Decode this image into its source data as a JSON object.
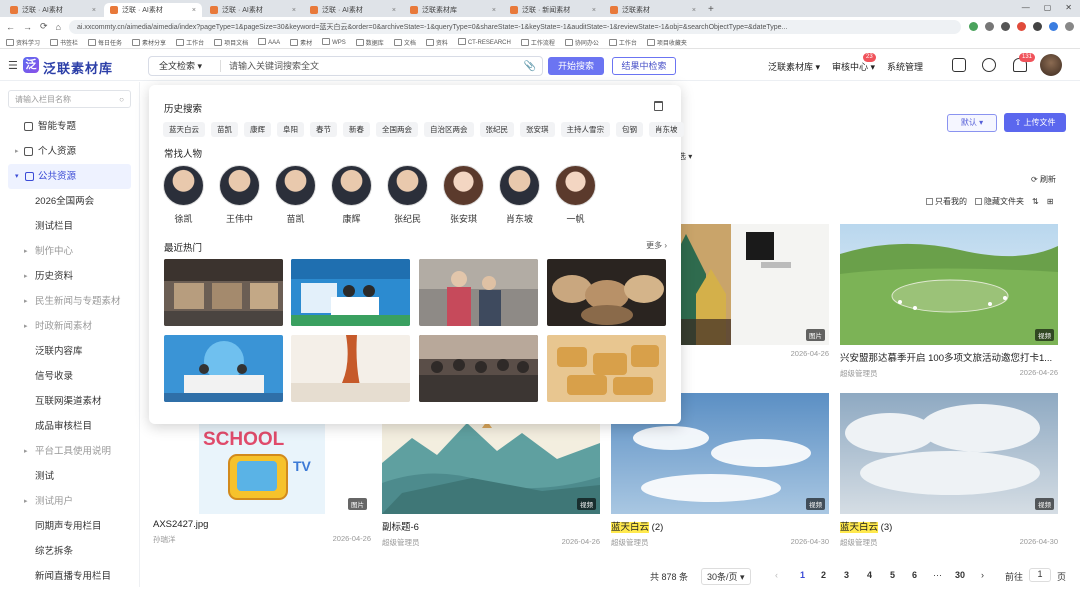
{
  "browser": {
    "tabs": [
      {
        "title": "泛联 · AI素材",
        "active": false
      },
      {
        "title": "泛联 · AI素材",
        "active": true
      },
      {
        "title": "泛联 · AI素材",
        "active": false
      },
      {
        "title": "泛联 · AI素材",
        "active": false
      },
      {
        "title": "泛联素材库",
        "active": false
      },
      {
        "title": "泛联 · 新闻素材",
        "active": false
      },
      {
        "title": "泛联素材",
        "active": false
      }
    ],
    "url": "ai.xxcommty.cn/aimedia/aimedia/index?pageType=1&pageSize=30&keyword=蓝天白云&order=0&archiveState=-1&queryType=0&shareState=-1&keyState=-1&auditState=-1&reviewState=-1&obj=&searchObjectType=&dateType...",
    "bookmarks": [
      "资料学习",
      "书签栏",
      "每日任务",
      "素材分享",
      "工作台",
      "项目文档",
      "AAA",
      "素材",
      "WPS",
      "数据库",
      "文档",
      "资料",
      "CT-RESEARCH",
      "工作流程",
      "协同办公",
      "工作台",
      "项目收藏夹"
    ]
  },
  "header": {
    "logo_text": "泛联素材库",
    "logo_mark": "泛",
    "search_type": "全文检索",
    "search_placeholder": "请输入关键词搜索全文",
    "btn_search": "开始搜索",
    "btn_within": "结果中检索",
    "lib_select": "泛联素材库",
    "review_center": "审核中心",
    "review_badge": "23",
    "system_manage": "系统管理",
    "notify_badge": "131"
  },
  "sidebar": {
    "search_placeholder": "请输入栏目名称",
    "items": [
      {
        "label": "智能专题"
      },
      {
        "label": "个人资源"
      },
      {
        "label": "公共资源"
      },
      {
        "label": "2026全国两会"
      },
      {
        "label": "测试栏目"
      },
      {
        "label": "制作中心"
      },
      {
        "label": "历史资料"
      },
      {
        "label": "民生新闻与专题素材"
      },
      {
        "label": "时政新闻素材"
      },
      {
        "label": "泛联内容库"
      },
      {
        "label": "信号收录"
      },
      {
        "label": "互联网渠道素材"
      },
      {
        "label": "成品审核栏目"
      },
      {
        "label": "平台工具使用说明"
      },
      {
        "label": "测试"
      },
      {
        "label": "测试用户"
      },
      {
        "label": "同期声专用栏目"
      },
      {
        "label": "综艺拆条"
      },
      {
        "label": "新闻直播专用栏目"
      }
    ]
  },
  "main": {
    "btn_default": "默认 ▾",
    "btn_upload": "上传文件",
    "refresh": "刷新",
    "filter_chip": "选 ▾",
    "only_mine": "只看我的",
    "hidden_folder": "隐藏文件夹",
    "cards": [
      {
        "title": "",
        "author": "",
        "date": "2026-04-26",
        "tag": "图片"
      },
      {
        "title": "兴安盟那达慕季开启 100多项文旅活动邀您打卡1...",
        "author": "超级管理员",
        "date": "2026-04-26",
        "tag": "视频"
      },
      {
        "title": "AXS2427.jpg",
        "author": "孙瑞洋",
        "date": "2026-04-26",
        "tag": "图片"
      },
      {
        "title": "副标题-6",
        "author": "超级管理员",
        "date": "2026-04-26",
        "tag": "视频"
      },
      {
        "title_hl": "蓝天白云",
        "title_rest": " (2)",
        "author": "超级管理员",
        "date": "2026-04-30",
        "tag": "视频"
      },
      {
        "title_hl": "蓝天白云",
        "title_rest": " (3)",
        "author": "超级管理员",
        "date": "2026-04-30",
        "tag": "视频"
      }
    ]
  },
  "pager": {
    "total": "共 878 条",
    "size": "30条/页 ▾",
    "pages": [
      "1",
      "2",
      "3",
      "4",
      "5",
      "6",
      "30"
    ],
    "ellipsis": "···",
    "goto": "前往",
    "page_input": "1",
    "page_unit": "页"
  },
  "dropdown": {
    "history_title": "历史搜索",
    "history": [
      "蓝天白云",
      "苗凯",
      "康辉",
      "阜阳",
      "春节",
      "新春",
      "全国两会",
      "自治区两会",
      "张纪民",
      "张安琪",
      "主持人雪宗",
      "包钢",
      "肖东坡"
    ],
    "people_title": "常找人物",
    "people": [
      {
        "name": "徐凯",
        "f": false
      },
      {
        "name": "王伟中",
        "f": false
      },
      {
        "name": "苗凯",
        "f": false
      },
      {
        "name": "康辉",
        "f": false
      },
      {
        "name": "张纪民",
        "f": false
      },
      {
        "name": "张安琪",
        "f": true
      },
      {
        "name": "肖东坡",
        "f": false
      },
      {
        "name": "一帆",
        "f": true
      }
    ],
    "hot_title": "最近热门",
    "more": "更多 ›"
  }
}
